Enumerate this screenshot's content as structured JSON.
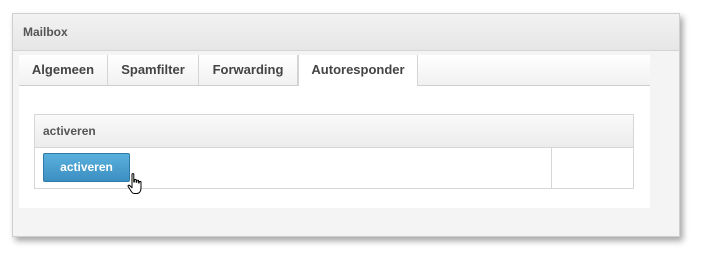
{
  "window": {
    "title": "Mailbox"
  },
  "tabs": [
    {
      "label": "Algemeen",
      "active": false
    },
    {
      "label": "Spamfilter",
      "active": false
    },
    {
      "label": "Forwarding",
      "active": false
    },
    {
      "label": "Autoresponder",
      "active": true
    }
  ],
  "panel": {
    "header": "activeren",
    "button_label": "activeren"
  },
  "colors": {
    "button": "#4a9fd1",
    "button_border": "#2f7aa6"
  },
  "icons": {
    "cursor": "hand-pointer-icon"
  }
}
